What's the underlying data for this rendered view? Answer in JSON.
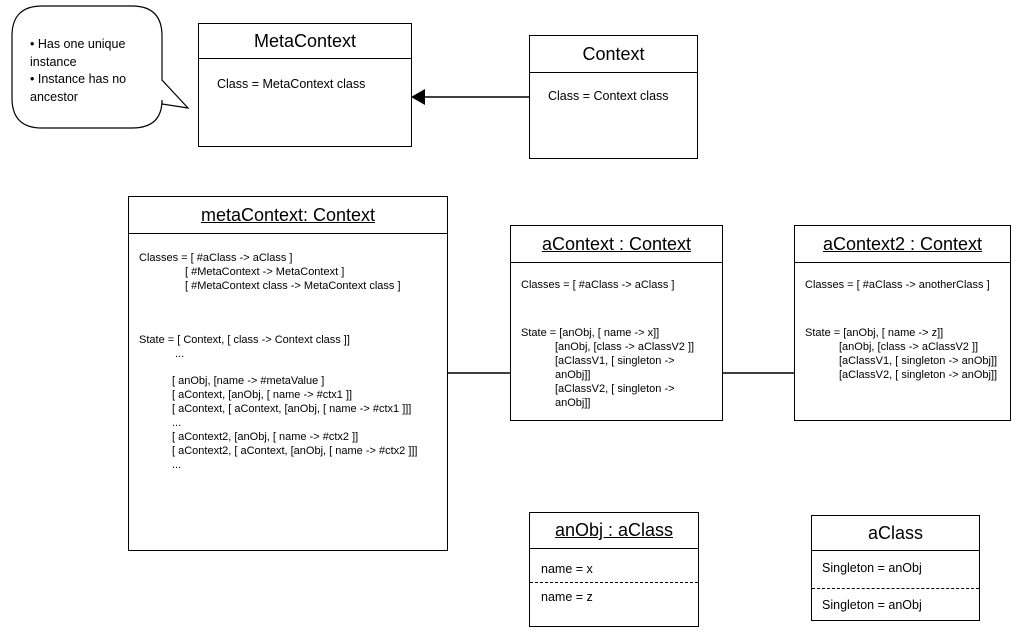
{
  "callout": {
    "lines": [
      "• Has one unique",
      "instance",
      "• Instance has no",
      "ancestor"
    ]
  },
  "meta_context_class": {
    "title": "MetaContext",
    "attribute": "Class = MetaContext class"
  },
  "context_class": {
    "title": "Context",
    "attribute": "Class = Context class"
  },
  "meta_context_instance": {
    "title": "metaContext: Context",
    "classes": [
      "Classes = [ #aClass -> aClass ]",
      "[ #MetaContext -> MetaContext ]",
      "[ #MetaContext class -> MetaContext class ]"
    ],
    "state": [
      "State =  [ Context, [ class -> Context class ]]",
      "...",
      "[ anObj, [name -> #metaValue ]",
      "[ aContext, [anObj, [ name -> #ctx1 ]]",
      "[ aContext, [ aContext, [anObj, [ name -> #ctx1 ]]]",
      "...",
      "[ aContext2, [anObj, [ name -> #ctx2 ]]",
      "[ aContext2, [ aContext, [anObj, [ name -> #ctx2 ]]]",
      "..."
    ]
  },
  "a_context": {
    "title": "aContext : Context",
    "classes": "Classes = [ #aClass -> aClass ]",
    "state": [
      "State = [anObj, [ name -> x]]",
      "[anObj, [class -> aClassV2 ]]",
      "[aClassV1, [ singleton -> anObj]]",
      "[aClassV2, [ singleton -> anObj]]"
    ]
  },
  "a_context2": {
    "title": "aContext2 : Context",
    "classes": "Classes = [ #aClass -> anotherClass ]",
    "state": [
      "State = [anObj, [ name -> z]]",
      "[anObj, [class -> aClassV2 ]]",
      "[aClassV1, [ singleton -> anObj]]",
      "[aClassV2, [ singleton -> anObj]]"
    ]
  },
  "an_obj": {
    "title": "anObj : aClass",
    "rows": [
      "name = x",
      "name = z"
    ]
  },
  "a_class": {
    "title": "aClass",
    "rows": [
      "Singleton = anObj",
      "Singleton = anObj"
    ]
  }
}
